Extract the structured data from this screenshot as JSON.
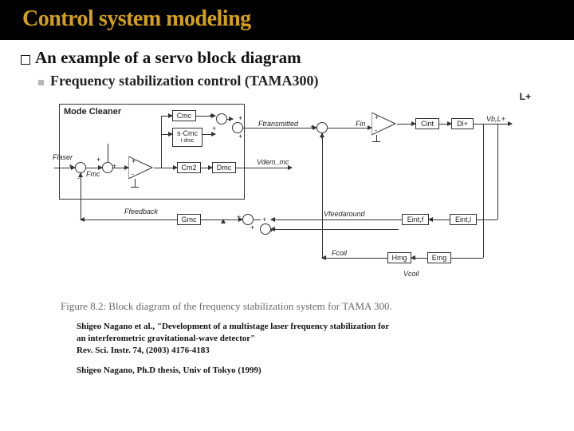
{
  "title": "Control system modeling",
  "heading": "An example of a servo block diagram",
  "subheading": "Frequency stabilization control (TAMA300)",
  "diagram": {
    "top_right": "L+",
    "mode_cleaner": "Mode Cleaner",
    "cmc": "Cmc",
    "scmc": "s·Cmc",
    "tdmc": "t dmc",
    "ftransmitted": "Ftransmitted",
    "cint": "Cint",
    "dlpl": "Dl+",
    "vbl": "Vb,L+",
    "flaser": "Flaser",
    "fmc": "Fmc",
    "cm2": "Cm2",
    "dmc": "Dmc",
    "vdem_mc": "Vdem_mc",
    "ffeedback": "Ffeedback",
    "gmc": "Gmc",
    "vfeedaround": "Vfeedaround",
    "eintf": "Eint,f",
    "eintl": "Eint,l",
    "fcoil": "Fcoil",
    "hmg": "Hmg",
    "emg": "Emg",
    "vcoil": "Vcoil"
  },
  "caption": "Figure 8.2: Block diagram of the frequency stabilization system for TAMA 300.",
  "ref1_line1": "Shigeo Nagano et al., \"Development of a multistage laser frequency stabilization for",
  "ref1_line2": "an interferometric gravitational-wave detector\"",
  "ref1_line3": "Rev. Sci. Instr.  74, (2003)  4176-4183",
  "ref2": "Shigeo Nagano, Ph.D thesis, Univ of Tokyo (1999)"
}
